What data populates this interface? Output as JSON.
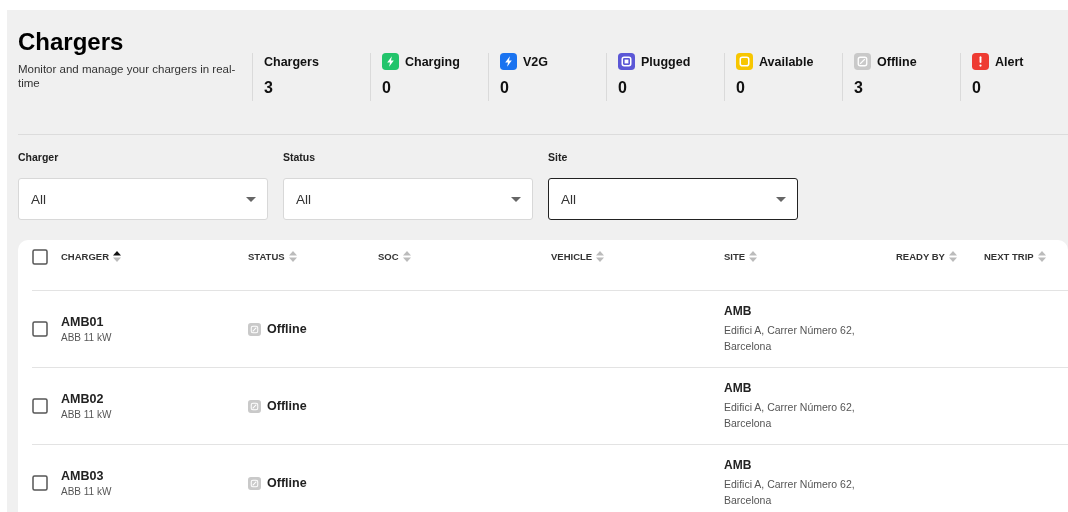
{
  "header": {
    "title": "Chargers",
    "subtitle": "Monitor and manage your chargers in real-time"
  },
  "stats": [
    {
      "kind": "total",
      "label": "Chargers",
      "value": "3"
    },
    {
      "kind": "charging",
      "label": "Charging",
      "value": "0"
    },
    {
      "kind": "v2g",
      "label": "V2G",
      "value": "0"
    },
    {
      "kind": "plugged",
      "label": "Plugged",
      "value": "0"
    },
    {
      "kind": "available",
      "label": "Available",
      "value": "0"
    },
    {
      "kind": "offline",
      "label": "Offline",
      "value": "3"
    },
    {
      "kind": "alert",
      "label": "Alert",
      "value": "0"
    }
  ],
  "filters": [
    {
      "label": "Charger",
      "value": "All",
      "focused": false
    },
    {
      "label": "Status",
      "value": "All",
      "focused": false
    },
    {
      "label": "Site",
      "value": "All",
      "focused": true
    }
  ],
  "table": {
    "select_all_checked": false,
    "columns": [
      {
        "label": "CHARGER",
        "sorted": true
      },
      {
        "label": "STATUS",
        "sorted": false
      },
      {
        "label": "SOC",
        "sorted": false
      },
      {
        "label": "VEHICLE",
        "sorted": false
      },
      {
        "label": "SITE",
        "sorted": false
      },
      {
        "label": "READY BY",
        "sorted": false
      },
      {
        "label": "NEXT TRIP",
        "sorted": false
      }
    ],
    "rows": [
      {
        "checked": false,
        "charger": "AMB01",
        "model": "ABB 11 kW",
        "status": {
          "kind": "offline",
          "label": "Offline"
        },
        "site": "AMB",
        "address": "Edifici A, Carrer Número 62, Barcelona"
      },
      {
        "checked": false,
        "charger": "AMB02",
        "model": "ABB 11 kW",
        "status": {
          "kind": "offline",
          "label": "Offline"
        },
        "site": "AMB",
        "address": "Edifici A, Carrer Número 62, Barcelona"
      },
      {
        "checked": false,
        "charger": "AMB03",
        "model": "ABB 11 kW",
        "status": {
          "kind": "offline",
          "label": "Offline"
        },
        "site": "AMB",
        "address": "Edifici A, Carrer Número 62, Barcelona"
      }
    ]
  }
}
